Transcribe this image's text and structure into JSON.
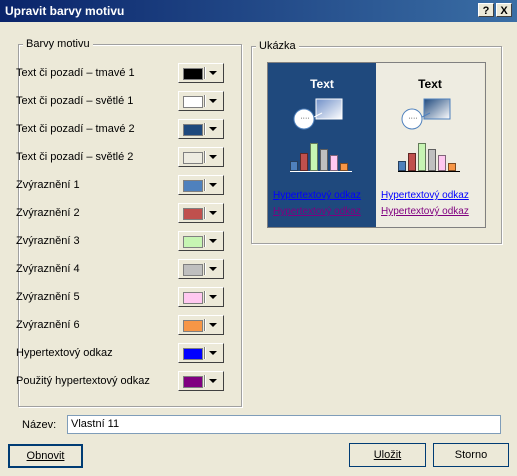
{
  "window": {
    "title": "Upravit barvy motivu",
    "help_label": "?",
    "close_label": "X"
  },
  "colors_group": {
    "title": "Barvy motivu",
    "rows": [
      {
        "label": "Text či pozadí – tmavé 1",
        "color": "#000000"
      },
      {
        "label": "Text či pozadí – světlé 1",
        "color": "#ffffff"
      },
      {
        "label": "Text či pozadí – tmavé 2",
        "color": "#1f497d"
      },
      {
        "label": "Text či pozadí – světlé 2",
        "color": "#eeece1"
      },
      {
        "label": "Zvýraznění 1",
        "color": "#4f81bd"
      },
      {
        "label": "Zvýraznění 2",
        "color": "#c0504d"
      },
      {
        "label": "Zvýraznění 3",
        "color": "#c7f5b3"
      },
      {
        "label": "Zvýraznění 4",
        "color": "#bfbfbf"
      },
      {
        "label": "Zvýraznění 5",
        "color": "#ffc8f0"
      },
      {
        "label": "Zvýraznění 6",
        "color": "#f79646"
      },
      {
        "label": "Hypertextový odkaz",
        "color": "#0000ff"
      },
      {
        "label": "Použitý hypertextový odkaz",
        "color": "#800080"
      }
    ]
  },
  "sample_group": {
    "title": "Ukázka",
    "dark": {
      "text": "Text",
      "link": "Hypertextový odkaz",
      "visited_link": "Hypertextový odkaz",
      "bg": "#1f497d"
    },
    "light": {
      "text": "Text",
      "link": "Hypertextový odkaz",
      "visited_link": "Hypertextový odkaz",
      "bg": "#eeece1"
    },
    "bubble_text": "····"
  },
  "name_field": {
    "label": "Název:",
    "value": "Vlastní 11"
  },
  "buttons": {
    "reset": "Obnovit",
    "save": "Uložit",
    "cancel": "Storno"
  }
}
